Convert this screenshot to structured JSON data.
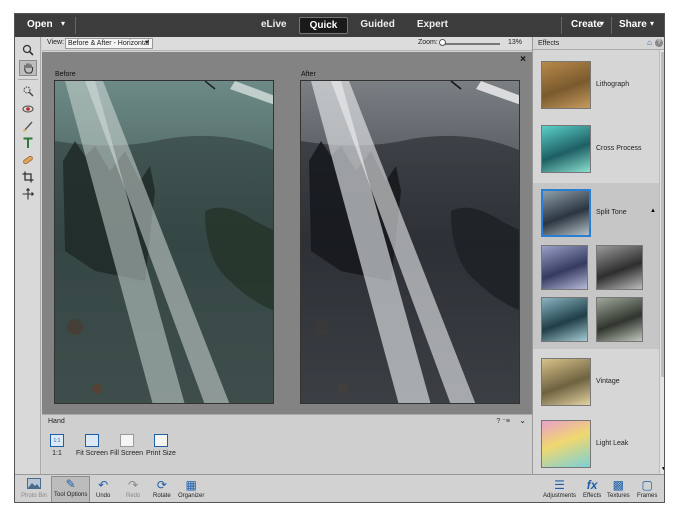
{
  "topbar": {
    "open_label": "Open",
    "modes": [
      {
        "label": "eLive",
        "active": false
      },
      {
        "label": "Quick",
        "active": true
      },
      {
        "label": "Guided",
        "active": false
      },
      {
        "label": "Expert",
        "active": false
      }
    ],
    "create_label": "Create",
    "share_label": "Share",
    "caret": "▾"
  },
  "toolbox": {
    "tools": [
      {
        "name": "zoom-tool",
        "icon": "magnifier-icon",
        "glyph": "🔍"
      },
      {
        "name": "hand-tool",
        "icon": "hand-icon",
        "glyph": "✋",
        "selected": true
      },
      {
        "name": "quick-selection-tool",
        "icon": "quick-selection-icon",
        "glyph": "⌕"
      },
      {
        "name": "red-eye-tool",
        "icon": "eye-icon",
        "glyph": "◉"
      },
      {
        "name": "whiten-teeth-tool",
        "icon": "brush-icon",
        "glyph": "⁄"
      },
      {
        "name": "type-tool",
        "icon": "type-icon",
        "glyph": "T"
      },
      {
        "name": "spot-healing-tool",
        "icon": "bandage-icon",
        "glyph": "◆"
      },
      {
        "name": "crop-tool",
        "icon": "crop-icon",
        "glyph": "⌗"
      },
      {
        "name": "move-tool",
        "icon": "move-icon",
        "glyph": "✥"
      }
    ]
  },
  "viewbar": {
    "view_label": "View:",
    "view_value": "Before & After - Horizontal",
    "zoom_label": "Zoom:",
    "zoom_value": "13%",
    "zoom_level": 0.13
  },
  "canvas": {
    "before_label": "Before",
    "after_label": "After",
    "close_glyph": "×"
  },
  "tool_options": {
    "title": "Hand",
    "help_glyph": "? ⁻≡",
    "collapse_glyph": "⌄",
    "buttons": [
      {
        "label": "1:1",
        "icon_text": "1:1"
      },
      {
        "label": "Fit Screen",
        "icon_text": ""
      },
      {
        "label": "Fill Screen",
        "icon_text": ""
      },
      {
        "label": "Print Size",
        "icon_text": ""
      }
    ]
  },
  "effects_panel": {
    "title": "Effects",
    "items": [
      {
        "label": "Lithograph"
      },
      {
        "label": "Cross Process"
      },
      {
        "label": "Split Tone",
        "selected": true
      },
      {
        "label": "Vintage"
      },
      {
        "label": "Light Leak"
      }
    ]
  },
  "bottombar": {
    "items": [
      {
        "label": "Photo Bin",
        "icon": "photo-bin-icon",
        "glyph": "▣",
        "dim": true
      },
      {
        "label": "Tool Options",
        "icon": "tool-options-icon",
        "glyph": "✎",
        "active": true
      },
      {
        "label": "Undo",
        "icon": "undo-icon",
        "glyph": "↶"
      },
      {
        "label": "Redo",
        "icon": "redo-icon",
        "glyph": "↷",
        "dim": true
      },
      {
        "label": "Rotate",
        "icon": "rotate-icon",
        "glyph": "⟳"
      },
      {
        "label": "Organizer",
        "icon": "organizer-icon",
        "glyph": "▦"
      },
      {
        "label": "Adjustments",
        "icon": "adjustments-icon",
        "glyph": "☰"
      },
      {
        "label": "Effects",
        "icon": "fx-icon",
        "glyph": "fx"
      },
      {
        "label": "Textures",
        "icon": "textures-icon",
        "glyph": "▩"
      },
      {
        "label": "Frames",
        "icon": "frames-icon",
        "glyph": "▢"
      }
    ]
  },
  "colors": {
    "accent": "#2a7fd4",
    "topbar_bg": "#3c3c3c",
    "canvas_bg": "#838383"
  }
}
